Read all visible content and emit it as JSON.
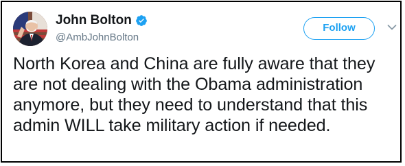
{
  "tweet": {
    "author_name": "John Bolton",
    "author_handle": "@AmbJohnBolton",
    "verified": true,
    "follow_label": "Follow",
    "text": "North Korea and China are fully aware that they are not dealing with the Obama administration anymore, but they need to understand that this admin WILL take military action if needed."
  },
  "colors": {
    "accent": "#1da1f2",
    "handle": "#657786",
    "text": "#14171a"
  },
  "icons": {
    "verified": "verified-badge-icon",
    "menu": "chevron-down-icon"
  }
}
